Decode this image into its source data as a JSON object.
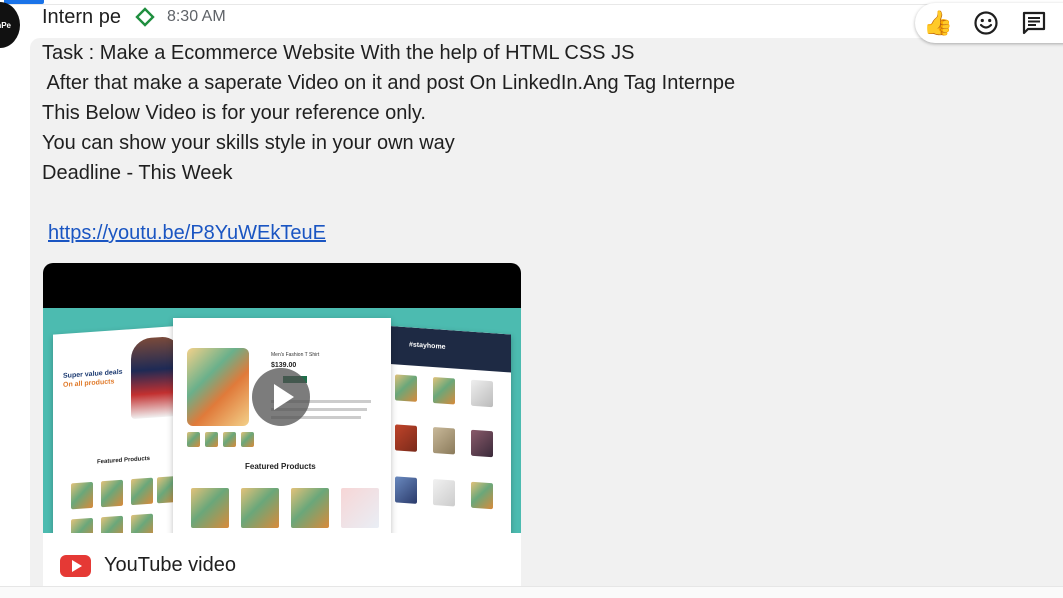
{
  "message": {
    "sender": "Intern pe",
    "avatar_text": "nPe",
    "time": "8:30 AM",
    "lines": [
      "Task : Make a Ecommerce Website With the help of HTML CSS JS",
      " After that make a saperate Video on it and post On LinkedIn.Ang Tag Internpe",
      "This Below Video is for your reference only.",
      "You can show your skills style in your own way",
      "Deadline - This Week"
    ],
    "link": "https://youtu.be/P8YuWEkTeuE"
  },
  "reactions": {
    "items": [
      {
        "name": "thumbs-up-icon",
        "glyph": "👍"
      },
      {
        "name": "add-emoji-icon"
      },
      {
        "name": "reply-in-thread-icon"
      }
    ]
  },
  "video_card": {
    "label": "YouTube video",
    "thumbnail": {
      "left_banner_line1": "Super value deals",
      "left_banner_line2": "On all products",
      "left_section_title": "Featured Products",
      "center_product_name": "Men's Fashion T Shirt",
      "center_price": "$139.00",
      "center_section_title": "Featured Products",
      "right_brand": "#stayhome"
    }
  },
  "colors": {
    "link": "#1a55c2",
    "youtube_red": "#e53935",
    "badge_green": "#1e8e3e",
    "thumbnail_teal": "#4cbbb0"
  }
}
